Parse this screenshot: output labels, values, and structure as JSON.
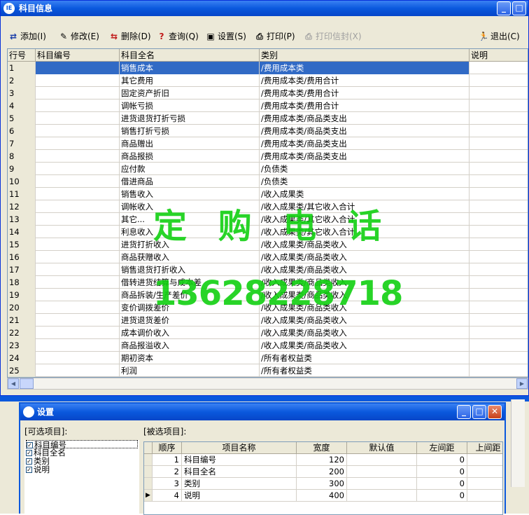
{
  "window": {
    "title": "科目信息",
    "app_icon_text": "IE"
  },
  "toolbar": {
    "add": "添加(I)",
    "edit": "修改(E)",
    "delete": "删除(D)",
    "query": "查询(Q)",
    "settings": "设置(S)",
    "print": "打印(P)",
    "print_envelope": "打印信封(X)",
    "exit": "退出(C)"
  },
  "table": {
    "columns": [
      "行号",
      "科目编号",
      "科目全名",
      "类别",
      "说明"
    ],
    "rows": [
      [
        "1",
        "",
        "销售成本",
        "/费用成本类",
        ""
      ],
      [
        "2",
        "",
        "其它费用",
        "/费用成本类/费用合计",
        ""
      ],
      [
        "3",
        "",
        "固定资产折旧",
        "/费用成本类/费用合计",
        ""
      ],
      [
        "4",
        "",
        "调帐亏损",
        "/费用成本类/费用合计",
        ""
      ],
      [
        "5",
        "",
        "进货退货打折亏损",
        "/费用成本类/商品类支出",
        ""
      ],
      [
        "6",
        "",
        "销售打折亏损",
        "/费用成本类/商品类支出",
        ""
      ],
      [
        "7",
        "",
        "商品赠出",
        "/费用成本类/商品类支出",
        ""
      ],
      [
        "8",
        "",
        "商品报损",
        "/费用成本类/商品类支出",
        ""
      ],
      [
        "9",
        "",
        "应付款",
        "/负债类",
        ""
      ],
      [
        "10",
        "",
        "借进商品",
        "/负债类",
        ""
      ],
      [
        "11",
        "",
        "销售收入",
        "/收入成果类",
        ""
      ],
      [
        "12",
        "",
        "调帐收入",
        "/收入成果类/其它收入合计",
        ""
      ],
      [
        "13",
        "",
        "其它...",
        "/收入成果类/其它收入合计",
        ""
      ],
      [
        "14",
        "",
        "利息收入",
        "/收入成果类/其它收入合计",
        ""
      ],
      [
        "15",
        "",
        "进货打折收入",
        "/收入成果类/商品类收入",
        ""
      ],
      [
        "16",
        "",
        "商品获赠收入",
        "/收入成果类/商品类收入",
        ""
      ],
      [
        "17",
        "",
        "销售退货打折收入",
        "/收入成果类/商品类收入",
        ""
      ],
      [
        "18",
        "",
        "借转进货结算与成本差",
        "/收入成果类/商品类收入",
        ""
      ],
      [
        "19",
        "",
        "商品拆装/生产差价",
        "/收入成果类/商品类收入",
        ""
      ],
      [
        "20",
        "",
        "变价调拨差价",
        "/收入成果类/商品类收入",
        ""
      ],
      [
        "21",
        "",
        "进货退货差价",
        "/收入成果类/商品类收入",
        ""
      ],
      [
        "22",
        "",
        "成本调价收入",
        "/收入成果类/商品类收入",
        ""
      ],
      [
        "23",
        "",
        "商品报溢收入",
        "/收入成果类/商品类收入",
        ""
      ],
      [
        "24",
        "",
        "期初资本",
        "/所有者权益类",
        ""
      ],
      [
        "25",
        "",
        "利润",
        "/所有者权益类",
        ""
      ]
    ],
    "selected_row": "1"
  },
  "watermark": {
    "line1": "定 购 电 话",
    "line2": "13628228718",
    "color": "#11d011"
  },
  "settings_dialog": {
    "title": "设置",
    "available_label": "[可选项目]:",
    "selected_label": "[被选项目]:",
    "available_items": [
      "科目编号",
      "科目全名",
      "类别",
      "说明"
    ],
    "grid_columns": [
      "顺序",
      "项目名称",
      "宽度",
      "默认值",
      "左间距",
      "上间距"
    ],
    "grid_rows": [
      [
        "1",
        "科目编号",
        "120",
        "",
        "0",
        ""
      ],
      [
        "2",
        "科目全名",
        "200",
        "",
        "0",
        ""
      ],
      [
        "3",
        "类别",
        "300",
        "",
        "0",
        ""
      ],
      [
        "4",
        "说明",
        "400",
        "",
        "0",
        ""
      ]
    ]
  },
  "colors": {
    "titlebar": "#0a58dd",
    "selection": "#316ac5",
    "face": "#ece9d8"
  }
}
